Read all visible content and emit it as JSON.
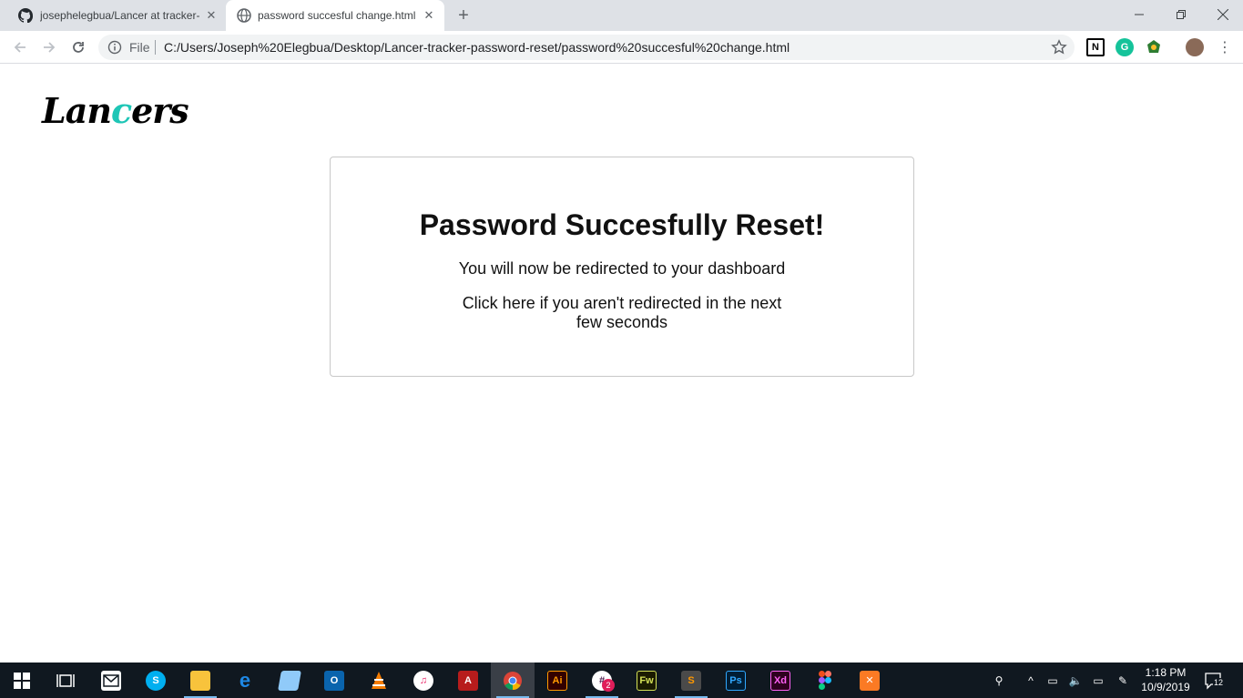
{
  "browser": {
    "tabs": [
      {
        "title": "josephelegbua/Lancer at tracker-",
        "icon": "github-icon",
        "active": false
      },
      {
        "title": "password succesful change.html",
        "icon": "globe-icon",
        "active": true
      }
    ],
    "omnibox": {
      "scheme_label": "File",
      "url": "C:/Users/Joseph%20Elegbua/Desktop/Lancer-tracker-password-reset/password%20succesful%20change.html"
    },
    "extensions": [
      "notion-icon",
      "grammarly-icon",
      "vpn-icon"
    ]
  },
  "page": {
    "logo": {
      "part1": "Lan",
      "accent": "c",
      "part2": "ers",
      "accent_color": "#1ec6b6"
    },
    "card": {
      "title": "Password Succesfully Reset!",
      "subtitle": "You will now be redirected to your dashboard",
      "link_line1": "Click here if you aren't redirected in the next",
      "link_line2": "few seconds"
    }
  },
  "taskbar": {
    "apps": [
      "start-icon",
      "task-view-icon",
      "mail-icon",
      "skype-icon",
      "file-explorer-icon",
      "edge-icon",
      "notepad-icon",
      "outlook-icon",
      "vlc-icon",
      "itunes-icon",
      "acrobat-icon",
      "chrome-icon",
      "illustrator-icon",
      "slack-icon",
      "fireworks-icon",
      "sublime-icon",
      "photoshop-icon",
      "xd-icon",
      "figma-icon",
      "xampp-icon"
    ],
    "slack_badge": "2",
    "clock_time": "1:18 PM",
    "clock_date": "10/9/2019",
    "notifications_count": "12"
  }
}
